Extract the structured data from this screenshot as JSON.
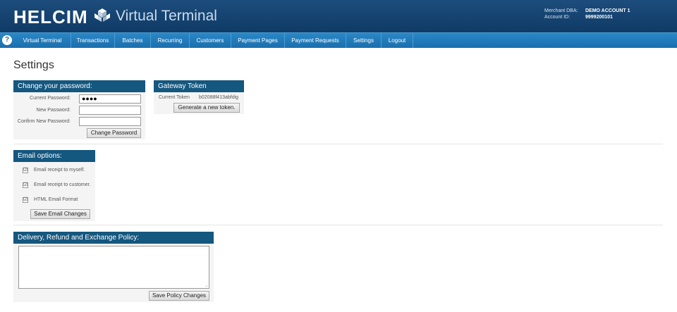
{
  "header": {
    "brand": "HELCIM",
    "brand_sub": "Virtual Terminal",
    "merchant_label": "Merchant DBA:",
    "merchant_value": "DEMO ACCOUNT 1",
    "account_label": "Account ID:",
    "account_value": "9999200101"
  },
  "nav": {
    "help": "?",
    "items": [
      {
        "label": "Virtual Terminal"
      },
      {
        "label": "Transactions"
      },
      {
        "label": "Batches"
      },
      {
        "label": "Recurring"
      },
      {
        "label": "Customers"
      },
      {
        "label": "Payment Pages"
      },
      {
        "label": "Payment Requests"
      },
      {
        "label": "Settings"
      },
      {
        "label": "Logout"
      }
    ]
  },
  "page": {
    "title": "Settings"
  },
  "password_panel": {
    "title": "Change your password:",
    "current_label": "Current Password:",
    "current_value": "●●●●",
    "new_label": "New Password:",
    "new_value": "",
    "confirm_label": "Confirm New Password:",
    "confirm_value": "",
    "button": "Change Password"
  },
  "token_panel": {
    "title": "Gateway Token",
    "current_label": "Current Token",
    "current_value": "b02088f413abfdig",
    "button": "Generate a new token."
  },
  "email_panel": {
    "title": "Email options:",
    "options": [
      {
        "label": "Email receipt to myself.",
        "checked": "☑"
      },
      {
        "label": "Email receipt to customer.",
        "checked": "☑"
      },
      {
        "label": "HTML Email Format",
        "checked": "☑"
      }
    ],
    "button": "Save Email Changes"
  },
  "policy_panel": {
    "title": "Delivery, Refund and Exchange Policy:",
    "text": "",
    "button": "Save Policy Changes"
  },
  "colors": {
    "header": "#0f3a66",
    "nav": "#1a6fae",
    "panel_head": "#14577f"
  }
}
